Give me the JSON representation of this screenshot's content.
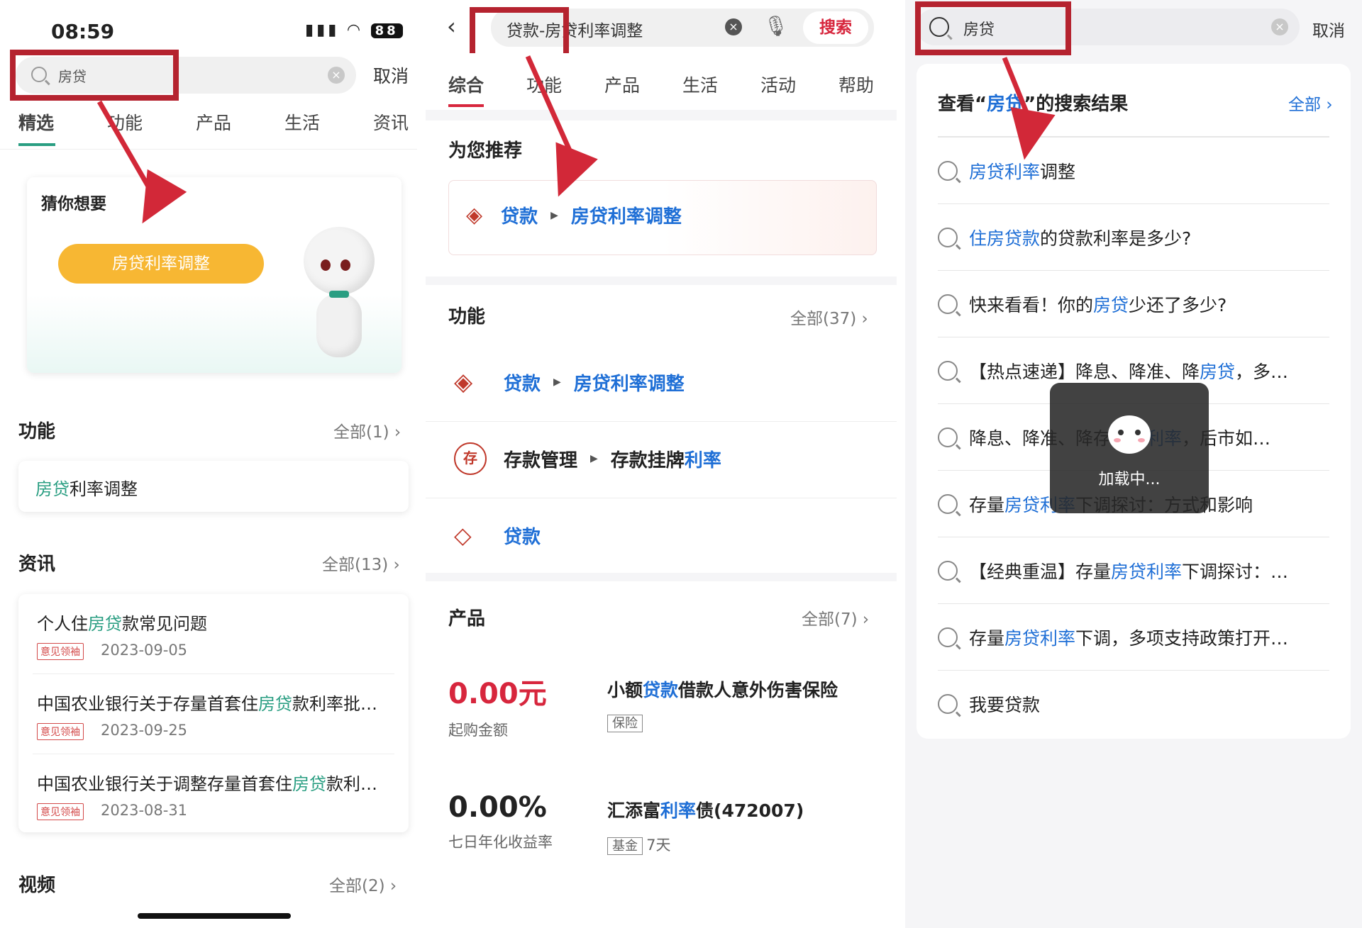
{
  "panel1": {
    "status": {
      "time": "08:59",
      "signal": "....",
      "battery": "88"
    },
    "search": {
      "query": "房贷",
      "cancel": "取消"
    },
    "tabs": [
      "精选",
      "功能",
      "产品",
      "生活",
      "资讯"
    ],
    "guess": {
      "title": "猜你想要",
      "button": "房贷利率调整"
    },
    "function_section": {
      "title": "功能",
      "all": "全部(1)",
      "item_hl": "房贷",
      "item_rest": "利率调整"
    },
    "news_section": {
      "title": "资讯",
      "all": "全部(13)",
      "items": [
        {
          "pre": "个人住",
          "hl": "房贷",
          "post": "款常见问题",
          "tag": "意见领袖",
          "date": "2023-09-05"
        },
        {
          "pre": "中国农业银行关于存量首套住",
          "hl": "房贷",
          "post": "款利率批…",
          "tag": "意见领袖",
          "date": "2023-09-25"
        },
        {
          "pre": "中国农业银行关于调整存量首套住",
          "hl": "房贷",
          "post": "款利…",
          "tag": "意见领袖",
          "date": "2023-08-31"
        }
      ]
    },
    "video_section": {
      "title": "视频",
      "all": "全部(2)"
    }
  },
  "panel2": {
    "search": {
      "query": "贷款-房贷利率调整",
      "search_button": "搜索"
    },
    "tabs": [
      "综合",
      "功能",
      "产品",
      "生活",
      "活动",
      "帮助"
    ],
    "recommend": {
      "title": "为您推荐",
      "crumb1": "贷款",
      "crumb2": "房贷利率调整"
    },
    "function_section": {
      "title": "功能",
      "all": "全部(37)",
      "rows": [
        {
          "a": "贷款",
          "b": "房贷利率调整",
          "icon": "layers-icon"
        },
        {
          "a": "存款管理",
          "b_pre": "存款挂牌",
          "b_hl": "利率",
          "icon": "deposit-icon"
        },
        {
          "a": "贷款",
          "icon": "loan-hand-icon"
        }
      ]
    },
    "product_section": {
      "title": "产品",
      "all": "全部(7)",
      "items": [
        {
          "value": "0.00元",
          "value_label": "起购金额",
          "name_pre": "小额",
          "name_hl": "贷款",
          "name_post": "借款人意外伤害保险",
          "tag": "保险",
          "extra": ""
        },
        {
          "value": "0.00%",
          "value_label": "七日年化收益率",
          "name_pre": "汇添富",
          "name_hl": "利率",
          "name_post": "债(472007)",
          "tag": "基金",
          "extra": "7天"
        }
      ]
    }
  },
  "panel3": {
    "search": {
      "query": "房贷",
      "cancel": "取消"
    },
    "header": {
      "pre": "查看“",
      "hl": "房贷",
      "post": "”的搜索结果",
      "all": "全部"
    },
    "results": [
      {
        "parts": [
          [
            "房贷利率",
            "hl"
          ],
          [
            "调整",
            ""
          ]
        ]
      },
      {
        "parts": [
          [
            "住房贷款",
            "hl"
          ],
          [
            "的贷款利率是多少?",
            ""
          ]
        ]
      },
      {
        "parts": [
          [
            "快来看看！你的",
            ""
          ],
          [
            "房贷",
            "hl"
          ],
          [
            "少还了多少?",
            ""
          ]
        ]
      },
      {
        "parts": [
          [
            "【热点速递】降息、降准、降",
            ""
          ],
          [
            "房贷",
            "hl"
          ],
          [
            "，多…",
            ""
          ]
        ]
      },
      {
        "parts": [
          [
            "降息、降准、降存",
            ""
          ],
          [
            "房贷利率",
            "hl"
          ],
          [
            "，后市如…",
            ""
          ]
        ]
      },
      {
        "parts": [
          [
            "存量",
            ""
          ],
          [
            "房贷利率",
            "hl"
          ],
          [
            "下调探讨：方式和影响",
            ""
          ]
        ]
      },
      {
        "parts": [
          [
            "【经典重温】存量",
            ""
          ],
          [
            "房贷利率",
            "hl"
          ],
          [
            "下调探讨：…",
            ""
          ]
        ]
      },
      {
        "parts": [
          [
            "存量",
            ""
          ],
          [
            "房贷利率",
            "hl"
          ],
          [
            "下调，多项支持政策打开…",
            ""
          ]
        ]
      },
      {
        "parts": [
          [
            "我要贷款",
            ""
          ]
        ]
      }
    ],
    "loading": "加载中..."
  },
  "colors": {
    "highlight_red": "#b5232f",
    "green": "#2a9e82",
    "blue": "#1f6fd6",
    "red": "#d7263d",
    "orange": "#f7b733"
  }
}
